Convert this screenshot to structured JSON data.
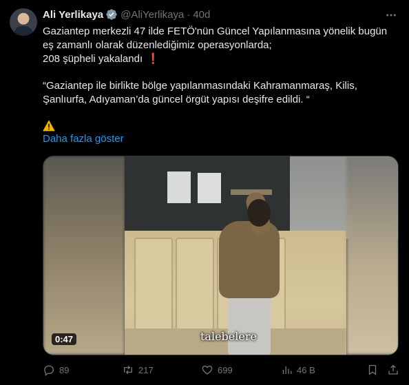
{
  "author": {
    "name": "Ali Yerlikaya",
    "handle": "@AliYerlikaya",
    "separator": "·",
    "time": "40d",
    "verified": true,
    "badge_color": "#829aab"
  },
  "tweet": {
    "line1": "Gaziantep merkezli 47 ilde FETÖ'nün Güncel Yapılanmasına yönelik bugün",
    "line2": "eş zamanlı olarak düzenlediğimiz operasyonlarda;",
    "line3": "208 şüpheli yakalandı",
    "line3_emoji": "❗",
    "quote_line1": "“Gaziantep ile birlikte bölge yapılanmasındaki Kahramanmaraş, Kilis,",
    "quote_line2": "Şanlıurfa, Adıyaman’da güncel örgüt yapısı deşifre edildi. “",
    "warning_emoji": "⚠️",
    "show_more": "Daha fazla göster"
  },
  "media": {
    "type": "video",
    "caption": "talebelere",
    "duration": "0:47"
  },
  "actions": {
    "replies": "89",
    "retweets": "217",
    "likes": "699",
    "views": "46 B"
  },
  "colors": {
    "background": "#000000",
    "text": "#e7e9ea",
    "muted": "#71767b",
    "link": "#1d9bf0",
    "warning": "#f4b400"
  }
}
